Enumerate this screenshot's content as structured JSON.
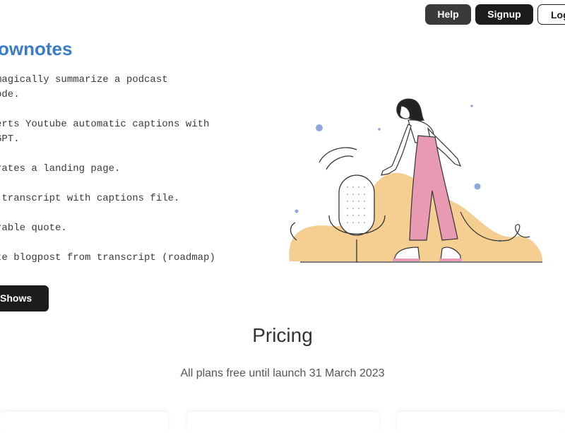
{
  "nav": {
    "help_label": "Help",
    "signup_label": "Signup",
    "login_label": "Log"
  },
  "hero": {
    "brand": "ownotes",
    "features": [
      "magically summarize a podcast\node.",
      "erts Youtube automatic captions with\nGPT.",
      "rates a landing page.",
      " transcript with captions file.",
      "rable quote.",
      "te blogpost from transcript (roadmap)"
    ],
    "shows_button": "Shows"
  },
  "pricing": {
    "title": "Pricing",
    "subtitle": "All plans free until launch 31 March 2023"
  },
  "colors": {
    "brand": "#3a7cc8",
    "dark_button": "#1c1c1c",
    "accent_shape": "#f5cf92",
    "pants": "#e99ab3",
    "dots": "#8fa9e0"
  }
}
